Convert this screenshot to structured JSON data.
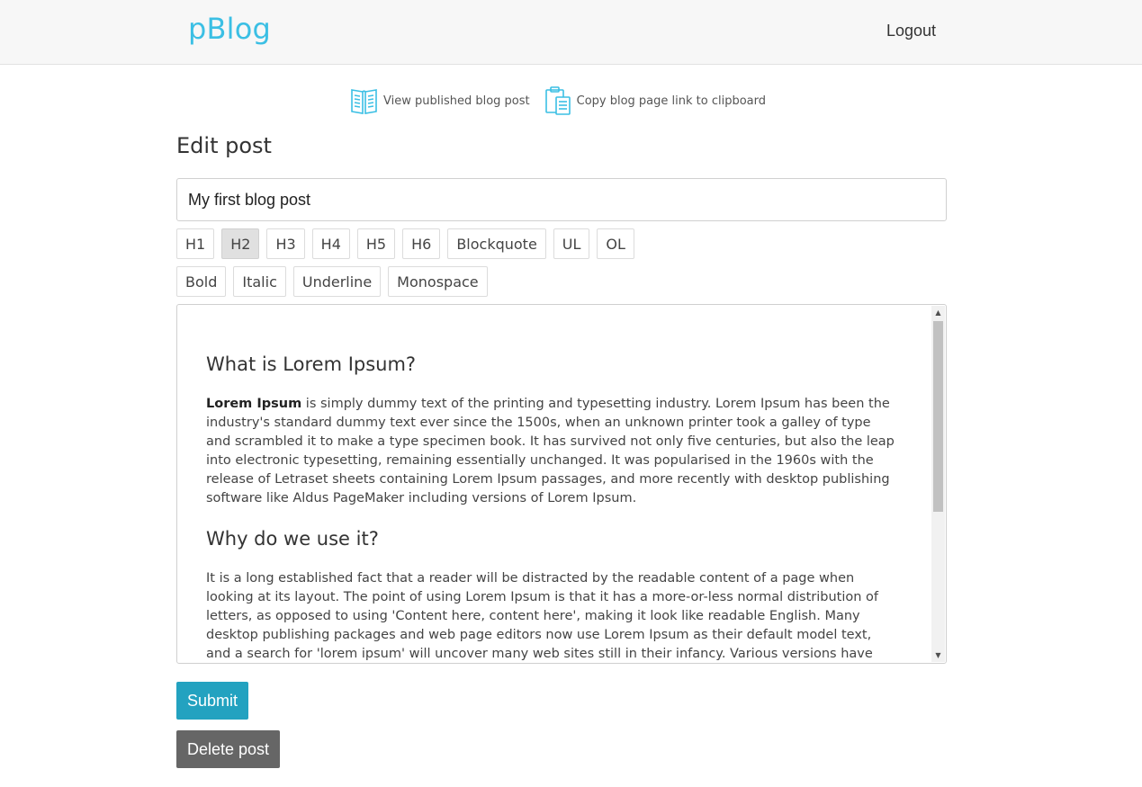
{
  "nav": {
    "brand": "pBlog",
    "logout_label": "Logout"
  },
  "actions": {
    "view_label": "View published blog post",
    "copy_label": "Copy blog page link to clipboard",
    "icon_color": "#3bbfe4"
  },
  "page_title": "Edit post",
  "post_title_value": "My first blog post",
  "toolbar": {
    "row1": [
      "H1",
      "H2",
      "H3",
      "H4",
      "H5",
      "H6",
      "Blockquote",
      "UL",
      "OL"
    ],
    "row2": [
      "Bold",
      "Italic",
      "Underline",
      "Monospace"
    ],
    "active": "H2"
  },
  "editor": {
    "heading1": "What is Lorem Ipsum?",
    "p1_bold": "Lorem Ipsum",
    "p1_rest": " is simply dummy text of the printing and typesetting industry. Lorem Ipsum has been the industry's standard dummy text ever since the 1500s, when an unknown printer took a galley of type and scrambled it to make a type specimen book. It has survived not only five centuries, but also the leap into electronic typesetting, remaining essentially unchanged. It was popularised in the 1960s with the release of Letraset sheets containing Lorem Ipsum passages, and more recently with desktop publishing software like Aldus PageMaker including versions of Lorem Ipsum.",
    "heading2": "Why do we use it?",
    "p2": "It is a long established fact that a reader will be distracted by the readable content of a page when looking at its layout. The point of using Lorem Ipsum is that it has a more-or-less normal distribution of letters, as opposed to using 'Content here, content here', making it look like readable English. Many desktop publishing packages and web page editors now use Lorem Ipsum as their default model text, and a search for 'lorem ipsum' will uncover many web sites still in their infancy. Various versions have evolved over the years,"
  },
  "buttons": {
    "submit_label": "Submit",
    "delete_label": "Delete post"
  },
  "colors": {
    "brand": "#3bbfe4",
    "submit": "#23a2c0",
    "delete": "#666666"
  }
}
